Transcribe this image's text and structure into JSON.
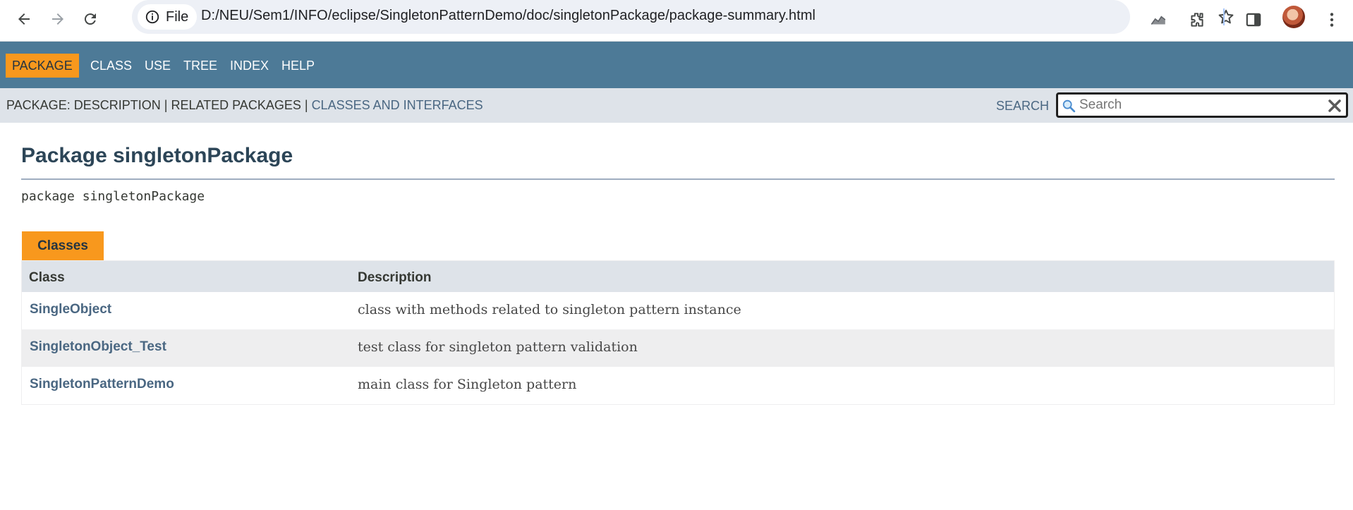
{
  "browser": {
    "site_chip_label": "File",
    "url": "D:/NEU/Sem1/INFO/eclipse/SingletonPatternDemo/doc/singletonPackage/package-summary.html",
    "icons": [
      "back-icon",
      "forward-icon",
      "reload-icon",
      "info-icon",
      "star-icon",
      "performance-icon",
      "extensions-icon",
      "side-panel-icon",
      "profile-avatar",
      "menu-icon"
    ]
  },
  "top_nav": {
    "items": [
      "PACKAGE",
      "CLASS",
      "USE",
      "TREE",
      "INDEX",
      "HELP"
    ],
    "active": "PACKAGE"
  },
  "sub_nav": {
    "package_label": "PACKAGE:",
    "description": "DESCRIPTION",
    "separator": "|",
    "related_packages": "RELATED PACKAGES",
    "classes_and_interfaces": "CLASSES AND INTERFACES",
    "search_label": "SEARCH",
    "search_placeholder": "Search"
  },
  "content": {
    "title": "Package singletonPackage",
    "signature": "package singletonPackage",
    "caption": "Classes",
    "columns": [
      "Class",
      "Description"
    ],
    "rows": [
      {
        "name": "SingleObject",
        "description": "class with methods related to singleton pattern instance"
      },
      {
        "name": "SingletonObject_Test",
        "description": "test class for singleton pattern validation"
      },
      {
        "name": "SingletonPatternDemo",
        "description": "main class for Singleton pattern"
      }
    ]
  },
  "colors": {
    "nav_bg": "#4d7a97",
    "subnav_bg": "#dee3e9",
    "accent": "#f8981d",
    "link": "#4a6782",
    "title": "#2c4557"
  }
}
